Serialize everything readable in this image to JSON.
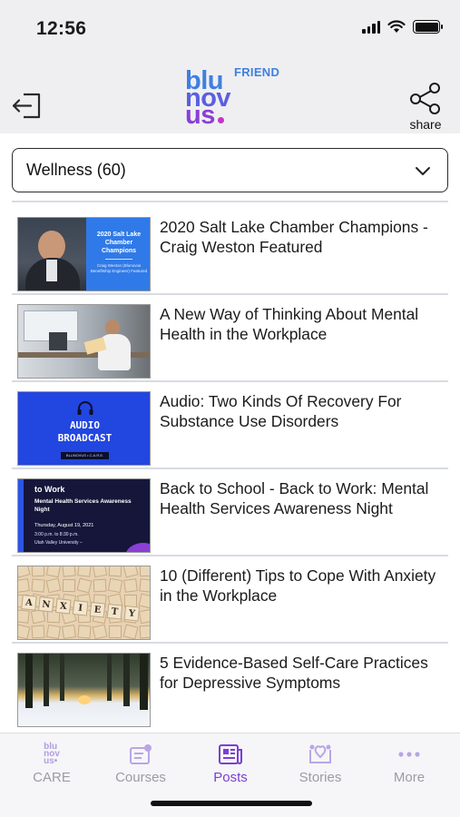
{
  "status_bar": {
    "time": "12:56"
  },
  "header": {
    "logo": {
      "line1": "blu",
      "line2": "nov",
      "line3": "us",
      "tag": "FRIEND"
    },
    "share_label": "share"
  },
  "filter": {
    "selected": "Wellness (60)"
  },
  "posts": [
    {
      "title": "2020 Salt Lake Chamber Champions - Craig Weston Featured",
      "thumb": {
        "heading": "2020 Salt Lake Chamber Champions",
        "sub": "Craig Weston (Blunovus Benefitship Engineer) Featured"
      }
    },
    {
      "title": "A New Way of Thinking About Mental Health in the Workplace",
      "thumb": {}
    },
    {
      "title": "Audio: Two Kinds Of Recovery For Substance Use Disorders",
      "thumb": {
        "line1": "AUDIO",
        "line2": "BROADCAST",
        "footer": "BLUNOVUS • C.A.R.E."
      }
    },
    {
      "title": "Back to School - Back to Work: Mental Health Services Awareness Night",
      "thumb": {
        "heading": "to Work",
        "sub": "Mental Health Services Awareness Night",
        "date": "Thursday, August 19, 2021",
        "time": "3:00 p.m. to 8:30 p.m.",
        "place": "Utah Valley University –"
      }
    },
    {
      "title": "10 (Different) Tips to Cope With Anxiety in the Workplace",
      "thumb": {
        "tiles": [
          "A",
          "N",
          "X",
          "I",
          "E",
          "T",
          "Y"
        ]
      }
    },
    {
      "title": "5 Evidence-Based Self-Care Practices for Depressive Symptoms",
      "thumb": {}
    }
  ],
  "tabs": [
    {
      "label": "CARE",
      "icon": "blunovus-logo-icon"
    },
    {
      "label": "Courses",
      "icon": "courses-icon"
    },
    {
      "label": "Posts",
      "icon": "posts-icon",
      "active": true
    },
    {
      "label": "Stories",
      "icon": "stories-icon"
    },
    {
      "label": "More",
      "icon": "more-dots-icon"
    }
  ],
  "colors": {
    "accent": "#7b3fd4",
    "logo_blue": "#3f7fe0",
    "logo_purple": "#8a3fd6",
    "tab_inactive": "#9b9ba4"
  }
}
